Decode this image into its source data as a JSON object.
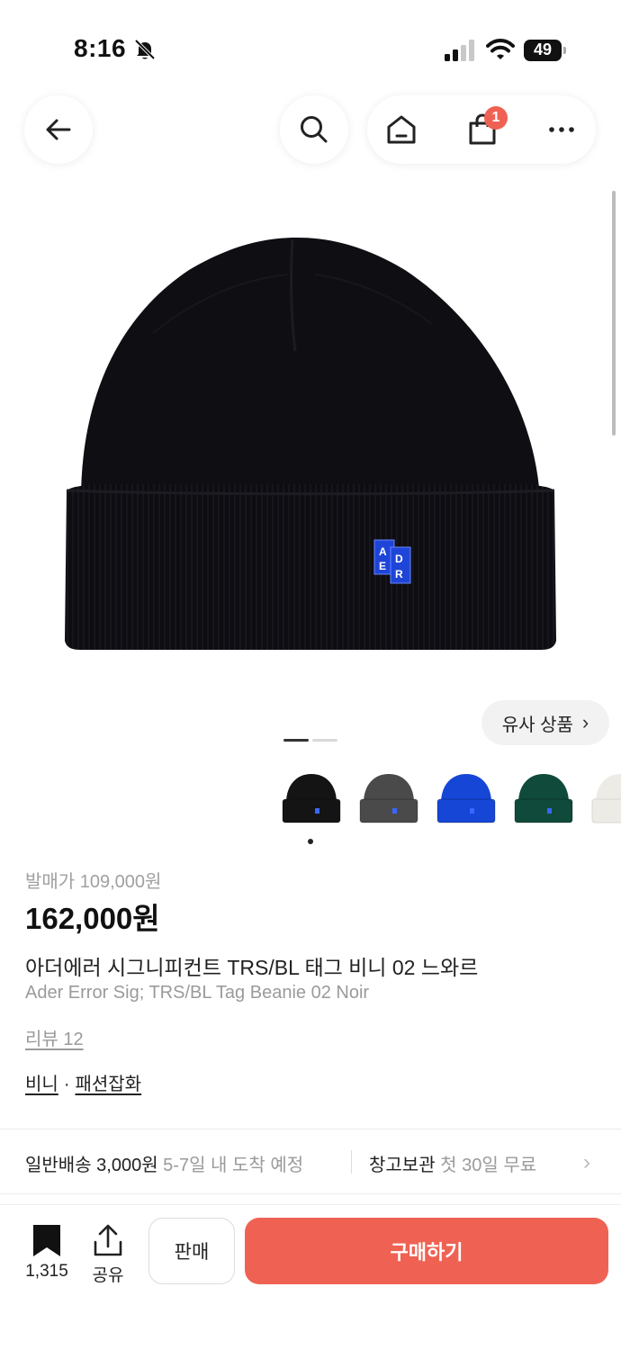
{
  "status_bar": {
    "time": "8:16",
    "battery": "49",
    "icons": [
      "bell-off-icon",
      "signal-icon",
      "wifi-icon",
      "battery-icon"
    ]
  },
  "nav": {
    "back_icon": "arrow-left-icon",
    "search_icon": "search-icon",
    "home_icon": "home-icon",
    "cart_icon": "shopping-bag-icon",
    "cart_badge": "1",
    "more_icon": "more-horizontal-icon"
  },
  "product_image": {
    "logo_letters": [
      "A",
      "E",
      "D",
      "R"
    ]
  },
  "similar_button": {
    "label": "유사 상품",
    "chevron": "›"
  },
  "thumbnails": {
    "colors": [
      "#141414",
      "#4a4a4a",
      "#1546d6",
      "#0f4a3a",
      "#ecebe6"
    ],
    "selected_index": 0
  },
  "product": {
    "release_price": "발매가 109,000원",
    "price": "162,000원",
    "title_ko": "아더에러 시그니피컨트 TRS/BL 태그 비니 02 느와르",
    "title_en": "Ader Error Sig; TRS/BL Tag Beanie 02 Noir",
    "review_link": "리뷰 12",
    "category_1": "비니",
    "category_sep": "·",
    "category_2": "패션잡화"
  },
  "shipping": {
    "label": "일반배송 3,000원",
    "eta": "5-7일 내 도착 예정",
    "storage_label": "창고보관",
    "storage_note": "첫 30일 무료",
    "chevron": "›"
  },
  "bottom_bar": {
    "bookmark_count": "1,315",
    "share_label": "공유",
    "sell_label": "판매",
    "buy_label": "구매하기"
  },
  "colors": {
    "accent": "#ef6253",
    "text": "#222222",
    "muted": "#9a9a9a"
  }
}
